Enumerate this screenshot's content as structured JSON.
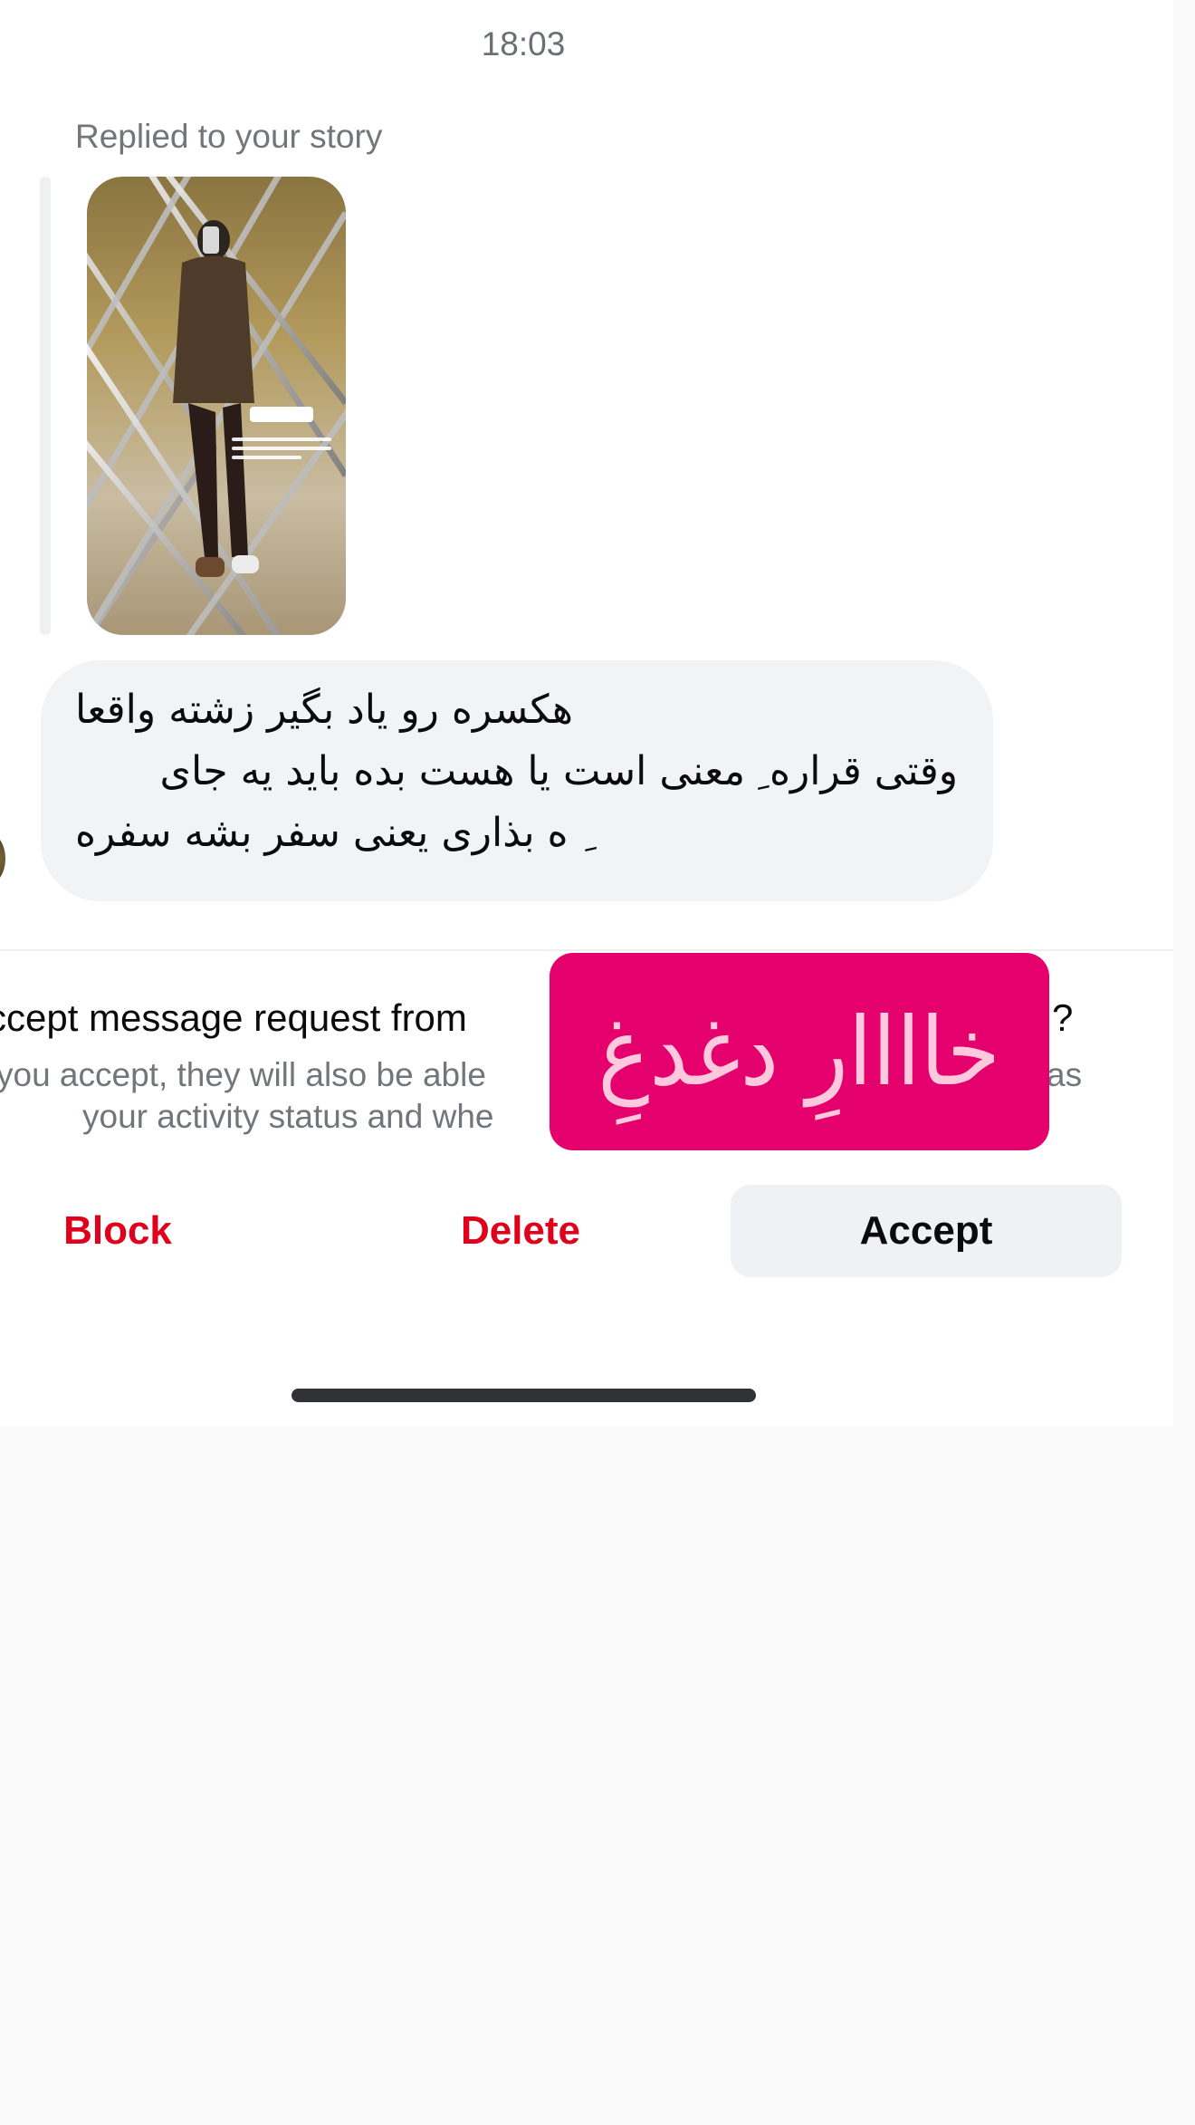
{
  "chat": {
    "timestamp": "18:03",
    "reply_label": "Replied to your story",
    "message_lines": [
      "هکسره رو یاد بگیر زشته واقعا",
      "وقتی قراره ِ معنی است یا هست بده باید یه جای",
      "ِ ه بذاری یعنی سفر بشه سفره"
    ]
  },
  "request": {
    "title": "ccept message request from",
    "title_end": "?",
    "description_line1": "you accept, they will also be able",
    "description_line1_end": "as",
    "description_line2": "your activity status and whe",
    "sender_name": "خاااارِ دغدغِ"
  },
  "actions": {
    "block_label": "Block",
    "delete_label": "Delete",
    "accept_label": "Accept"
  },
  "colors": {
    "destructive": "#e0001b",
    "sticker": "#e4006d",
    "bubble": "#f2f3f5",
    "accept_bg": "#eff1f4"
  }
}
